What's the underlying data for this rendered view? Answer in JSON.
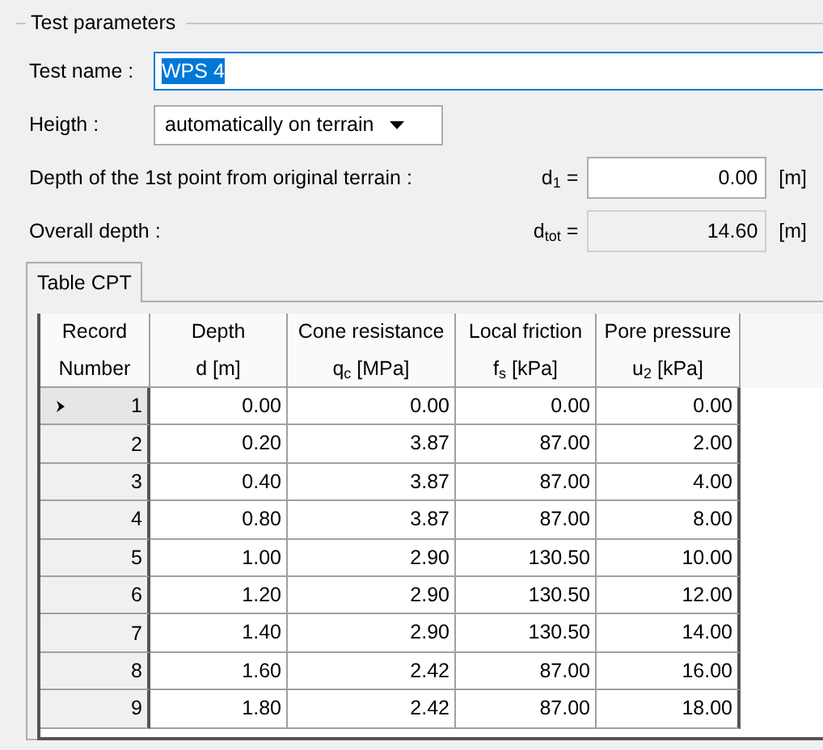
{
  "section": {
    "title": "Test parameters"
  },
  "fields": [
    {
      "kind": "text",
      "label": "Test name :",
      "value": "WPS 4",
      "text_selected": true
    },
    {
      "kind": "dropdown",
      "label": "Heigth :",
      "value": "automatically on terrain"
    },
    {
      "kind": "number",
      "label": "Depth of the 1st point from original terrain :",
      "symbol": "d$_{1}$ =",
      "value": "0.00",
      "unit": "[m]",
      "disabled": false
    },
    {
      "kind": "number",
      "label": "Overall depth :",
      "symbol": "d$_{tot}$ =",
      "value": "14.60",
      "unit": "[m]",
      "disabled": true
    }
  ],
  "tabs": [
    {
      "label": "Table CPT",
      "selected": true
    }
  ],
  "table": {
    "columns": [
      {
        "title": "Record",
        "subtitle": "Number"
      },
      {
        "title": "Depth",
        "subtitle": "d [m]"
      },
      {
        "title": "Cone resistance",
        "subtitle": "q$_{c}$ [MPa]"
      },
      {
        "title": "Local friction",
        "subtitle": "f$_{s}$ [kPa]"
      },
      {
        "title": "Pore pressure",
        "subtitle": "u$_{2}$ [kPa]"
      }
    ],
    "rows": [
      {
        "current": true,
        "cells": [
          "1",
          "0.00",
          "0.00",
          "0.00",
          "0.00"
        ]
      },
      {
        "current": false,
        "cells": [
          "2",
          "0.20",
          "3.87",
          "87.00",
          "2.00"
        ]
      },
      {
        "current": false,
        "cells": [
          "3",
          "0.40",
          "3.87",
          "87.00",
          "4.00"
        ]
      },
      {
        "current": false,
        "cells": [
          "4",
          "0.80",
          "3.87",
          "87.00",
          "8.00"
        ]
      },
      {
        "current": false,
        "cells": [
          "5",
          "1.00",
          "2.90",
          "130.50",
          "10.00"
        ]
      },
      {
        "current": false,
        "cells": [
          "6",
          "1.20",
          "2.90",
          "130.50",
          "12.00"
        ]
      },
      {
        "current": false,
        "cells": [
          "7",
          "1.40",
          "2.90",
          "130.50",
          "14.00"
        ]
      },
      {
        "current": false,
        "cells": [
          "8",
          "1.60",
          "2.42",
          "87.00",
          "16.00"
        ]
      },
      {
        "current": false,
        "cells": [
          "9",
          "1.80",
          "2.42",
          "87.00",
          "18.00"
        ]
      }
    ]
  }
}
